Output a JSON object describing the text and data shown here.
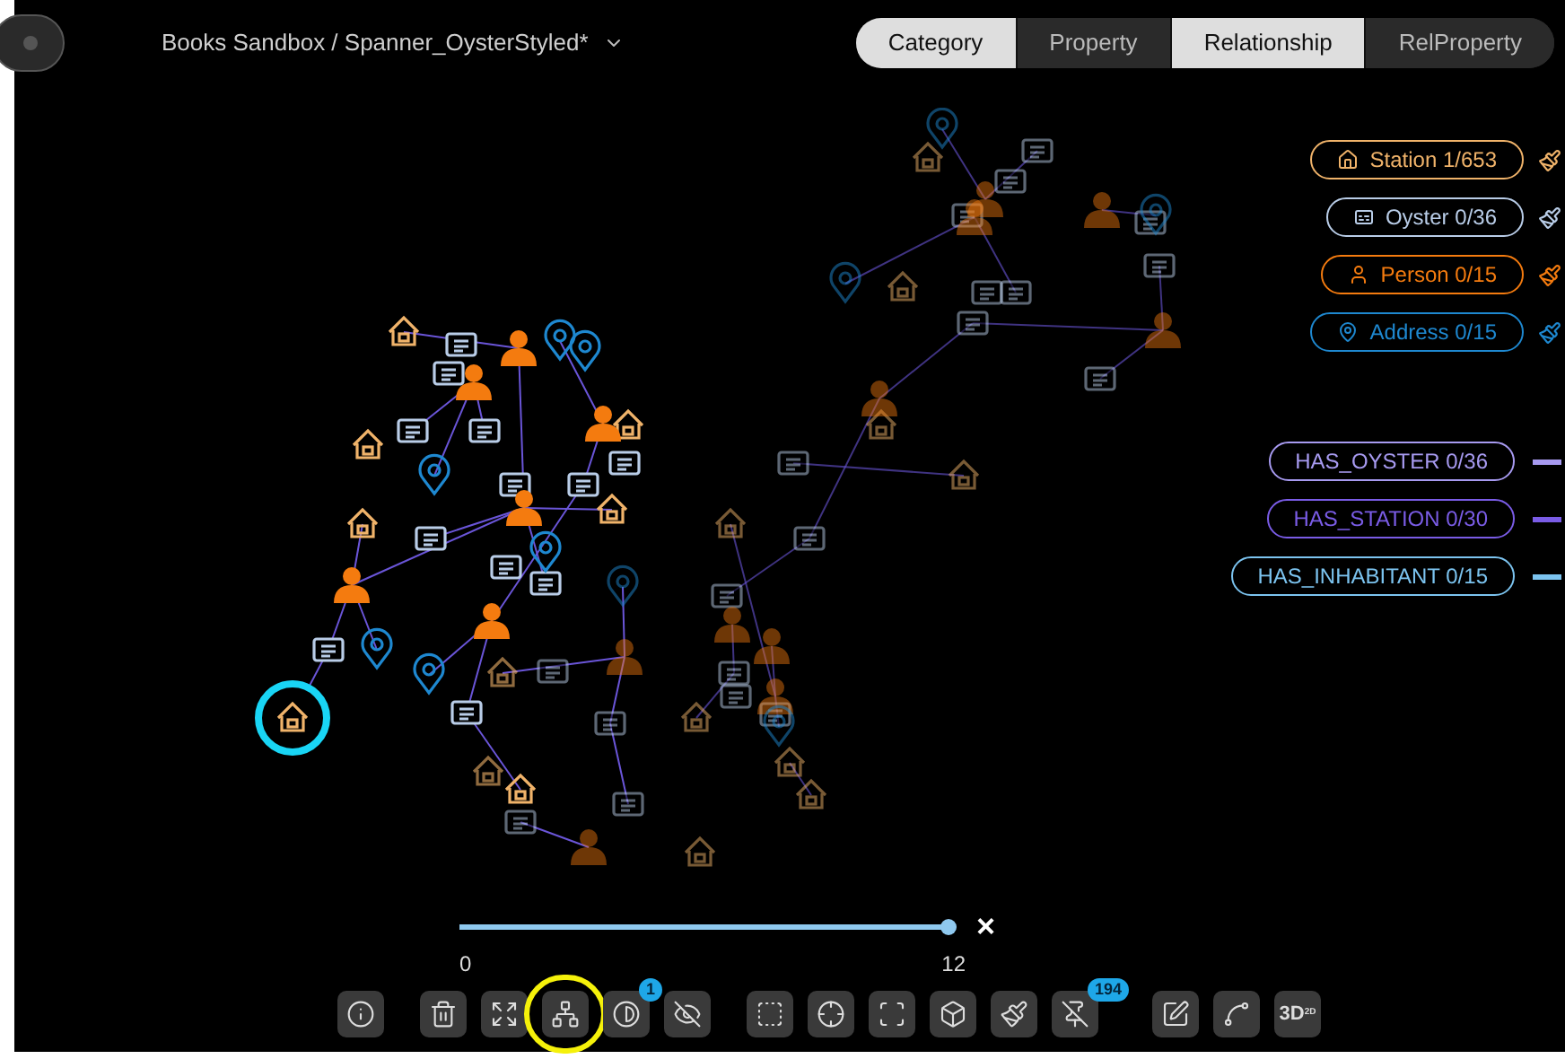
{
  "header": {
    "breadcrumb": "Books Sandbox / Spanner_OysterStyled*"
  },
  "tabs": [
    {
      "label": "Category",
      "selected": true
    },
    {
      "label": "Property",
      "selected": false
    },
    {
      "label": "Relationship",
      "selected": true
    },
    {
      "label": "RelProperty",
      "selected": false
    }
  ],
  "categories": [
    {
      "kind": "station",
      "label": "Station 1/653",
      "color": "#f0b36a"
    },
    {
      "kind": "oyster",
      "label": "Oyster 0/36",
      "color": "#b9cde8"
    },
    {
      "kind": "person",
      "label": "Person 0/15",
      "color": "#f47b0f"
    },
    {
      "kind": "address",
      "label": "Address 0/15",
      "color": "#1e88d0"
    }
  ],
  "relationships": [
    {
      "label": "HAS_OYSTER 0/36",
      "color": "#a79af0"
    },
    {
      "label": "HAS_STATION 0/30",
      "color": "#7a5ce6"
    },
    {
      "label": "HAS_INHABITANT 0/15",
      "color": "#7cc4f0"
    }
  ],
  "slider": {
    "level": 1,
    "min_label": "0",
    "max_label": "12",
    "close": "×"
  },
  "toolbar": [
    [
      {
        "kind": "info",
        "circled": false
      }
    ],
    [
      {
        "kind": "trash",
        "circled": false
      },
      {
        "kind": "expand",
        "circled": false
      },
      {
        "kind": "graph",
        "circled": true
      },
      {
        "kind": "contrast",
        "circled": false,
        "badge": "1"
      },
      {
        "kind": "eye-off",
        "circled": false
      }
    ],
    [
      {
        "kind": "select",
        "circled": false
      },
      {
        "kind": "crosshair",
        "circled": false
      },
      {
        "kind": "scan",
        "circled": false
      },
      {
        "kind": "cube",
        "circled": false
      },
      {
        "kind": "brush",
        "circled": false
      },
      {
        "kind": "pin-off",
        "circled": false,
        "badge": "194"
      }
    ],
    [
      {
        "kind": "pen",
        "circled": false
      },
      {
        "kind": "spline",
        "circled": false
      },
      {
        "kind": "mode",
        "circled": false,
        "label": "3D",
        "sup": "2D"
      }
    ]
  ]
}
